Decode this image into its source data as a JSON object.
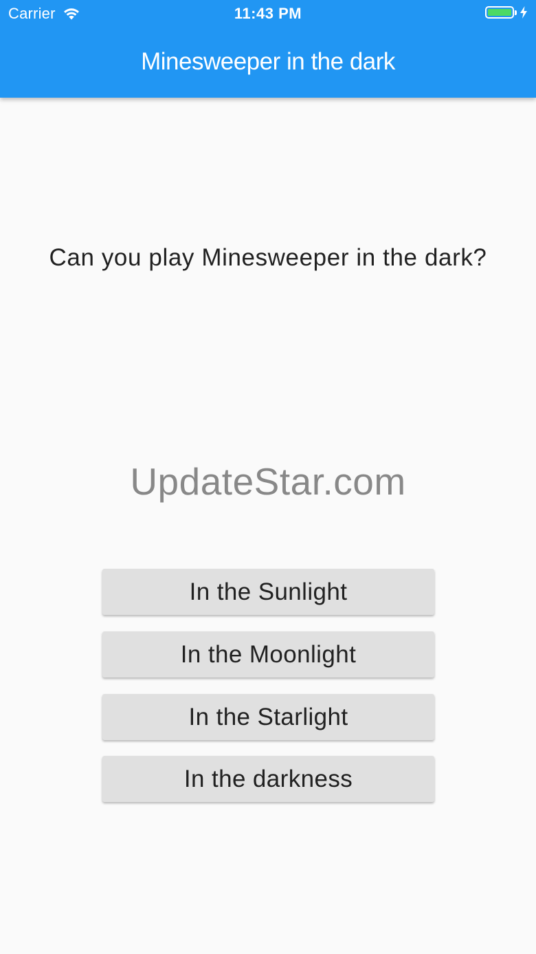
{
  "status_bar": {
    "carrier": "Carrier",
    "time": "11:43 PM",
    "battery_level": 1.0,
    "icons": [
      "wifi-icon",
      "battery-icon",
      "charging-bolt-icon"
    ]
  },
  "app_bar": {
    "title": "Minesweeper in the dark",
    "color": "#2196f3"
  },
  "main": {
    "question": "Can you play Minesweeper in the dark?",
    "watermark": "UpdateStar.com",
    "buttons": [
      {
        "label": "In the Sunlight"
      },
      {
        "label": "In the Moonlight"
      },
      {
        "label": "In the Starlight"
      },
      {
        "label": "In the darkness"
      }
    ]
  }
}
